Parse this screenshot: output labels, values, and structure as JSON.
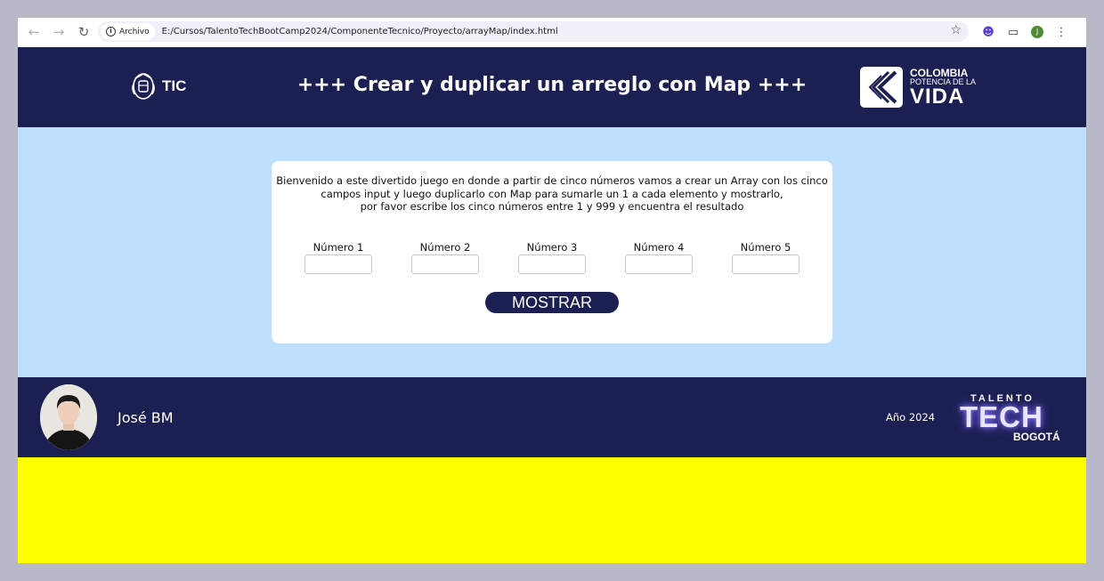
{
  "browser": {
    "chip_label": "Archivo",
    "url": "E:/Cursos/TalentoTechBootCamp2024/ComponenteTecnico/Proyecto/arrayMap/index.html",
    "profile_initial": "J"
  },
  "header": {
    "title": "+++ Crear y duplicar un arreglo con Map +++",
    "logo_tic": "TIC",
    "logo_colombia": {
      "line1": "COLOMBIA",
      "line2": "POTENCIA DE LA",
      "line3": "VIDA"
    }
  },
  "main": {
    "intro_line1": "Bienvenido a este divertido juego en donde a partir de cinco números vamos a crear un Array con los cinco",
    "intro_line2": "campos input y luego duplicarlo con Map para sumarle un 1 a cada elemento y mostrarlo,",
    "intro_line3": "por favor escribe los cinco números entre 1 y 999 y encuentra el resultado",
    "fields": [
      {
        "label": "Número 1",
        "value": ""
      },
      {
        "label": "Número 2",
        "value": ""
      },
      {
        "label": "Número 3",
        "value": ""
      },
      {
        "label": "Número 4",
        "value": ""
      },
      {
        "label": "Número 5",
        "value": ""
      }
    ],
    "button_label": "MOSTRAR"
  },
  "footer": {
    "author": "José BM",
    "year": "Año 2024",
    "logo_talento": "TALENTO",
    "logo_tech": "TECH",
    "logo_city": "BOGOTÁ"
  },
  "colors": {
    "navy": "#1c1f52",
    "light_blue": "#bedffe",
    "yellow": "#ffff00",
    "frame": "#b9b8c6"
  }
}
